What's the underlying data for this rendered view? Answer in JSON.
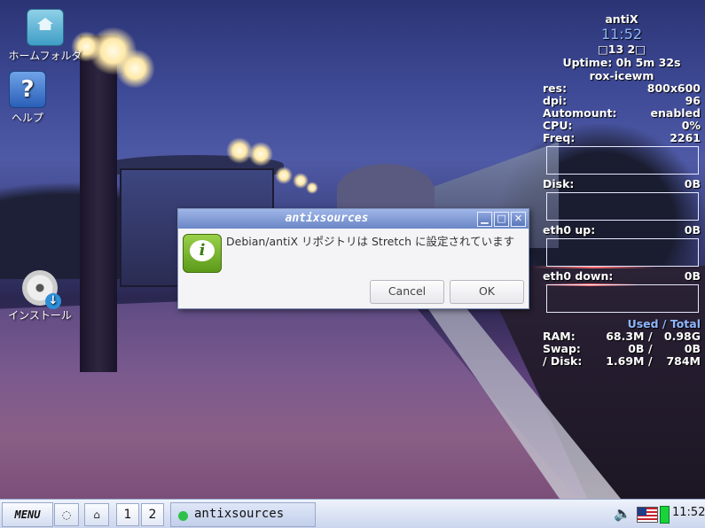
{
  "desktop": {
    "icons": [
      {
        "label": "ホームフォルダ",
        "icon": "home-folder-icon"
      },
      {
        "label": "ヘルプ",
        "icon": "help-icon",
        "glyph": "?"
      },
      {
        "label": "インストール",
        "icon": "install-disc-icon"
      }
    ]
  },
  "conky": {
    "hostname": "antiX",
    "time": "11:52",
    "date": "□13 2□",
    "uptime": "Uptime: 0h 5m 32s",
    "wm": "rox-icewm",
    "stats": [
      {
        "label": "res:",
        "value": "800x600"
      },
      {
        "label": "dpi:",
        "value": "96"
      },
      {
        "label": "Automount:",
        "value": "enabled"
      },
      {
        "label": "CPU:",
        "value": "0%"
      },
      {
        "label": "Freq:",
        "value": "2261"
      }
    ],
    "disk": {
      "label": "Disk:",
      "value": "0B"
    },
    "eth_up": {
      "label": "eth0 up:",
      "value": "0B"
    },
    "eth_down": {
      "label": "eth0 down:",
      "value": "0B"
    },
    "used_total_header": "Used / Total",
    "memory": [
      {
        "label": "RAM:",
        "used": "68.3M",
        "sep": "/",
        "total": "0.98G"
      },
      {
        "label": "Swap:",
        "used": "0B",
        "sep": "/",
        "total": "0B"
      },
      {
        "label": "/ Disk:",
        "used": "1.69M",
        "sep": "/",
        "total": "784M"
      }
    ]
  },
  "dialog": {
    "title": "antixsources",
    "message": "Debian/antiX リポジトリは Stretch に設定されています",
    "cancel_label": "Cancel",
    "ok_label": "OK",
    "minimize_glyph": "▁",
    "maximize_glyph": "□",
    "close_glyph": "✕",
    "icon_glyph": "i"
  },
  "taskbar": {
    "menu_label": "MENU",
    "show_desktop_glyph": "◌",
    "file_manager_glyph": "⌂",
    "workspaces": [
      "1",
      "2"
    ],
    "task_label": "antixsources",
    "volume_glyph": "🔈",
    "clock": "11:52"
  },
  "colors": {
    "dialog_titlebar": "#6a86c6",
    "conky_accent": "#8fb7ff",
    "battery": "#18d33a"
  }
}
